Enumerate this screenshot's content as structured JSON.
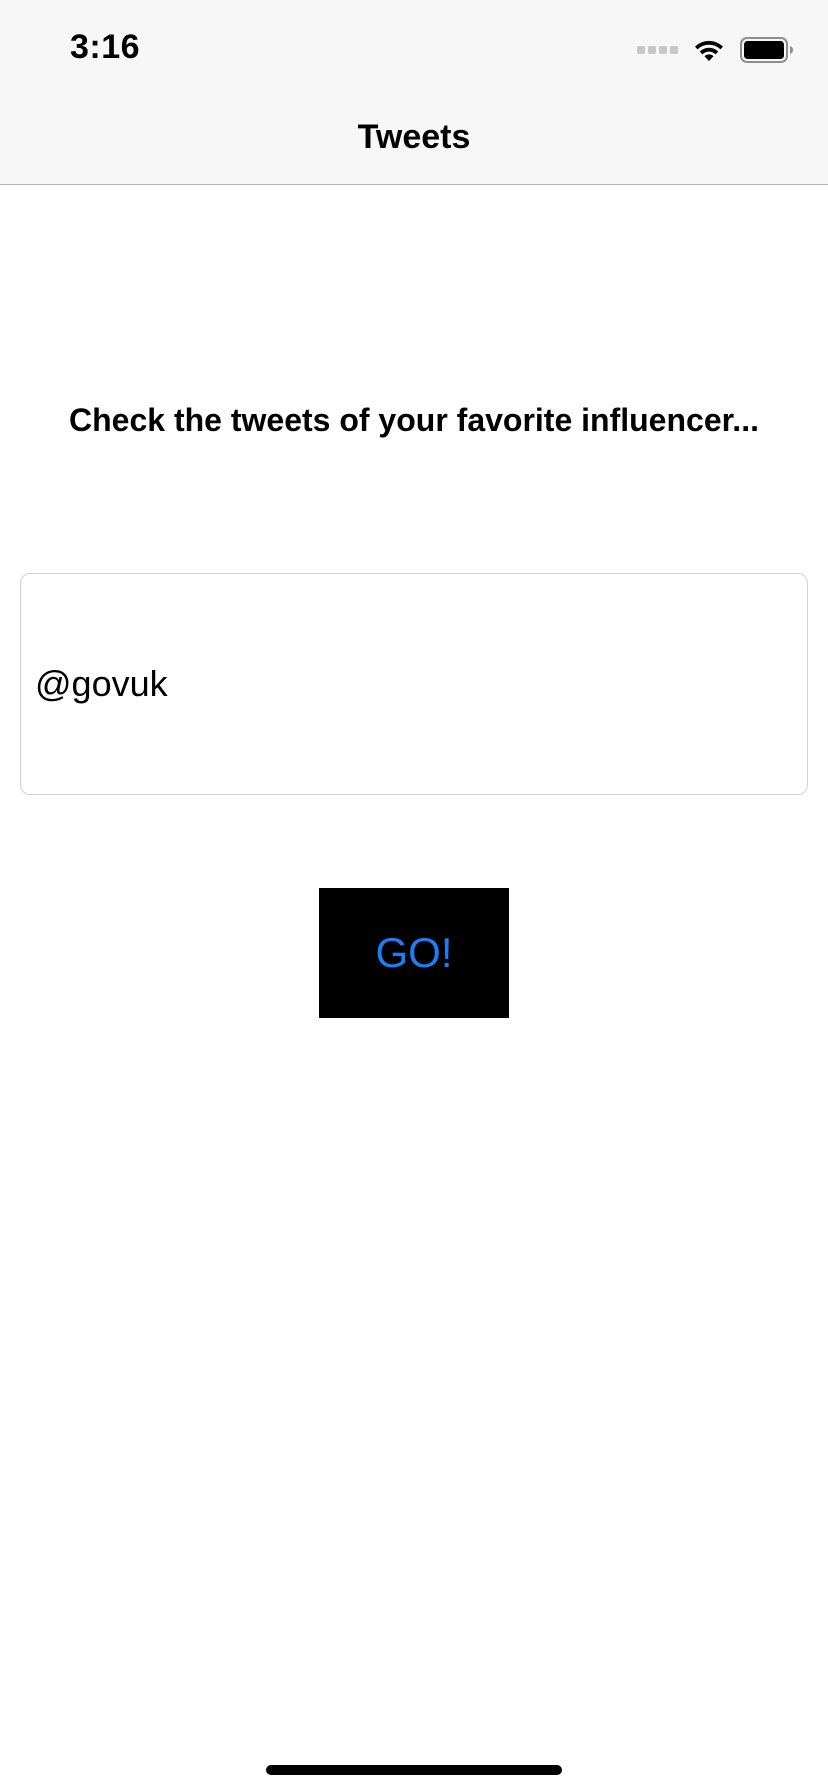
{
  "status_bar": {
    "time": "3:16",
    "icons": [
      "cellular-signal-icon",
      "wifi-icon",
      "battery-icon"
    ]
  },
  "nav": {
    "title": "Tweets"
  },
  "main": {
    "headline": "Check the tweets of your favorite influencer...",
    "handle_input_value": "@govuk",
    "go_button_label": "GO!"
  },
  "colors": {
    "nav_background": "#f7f7f7",
    "button_background": "#000000",
    "button_text": "#1a7ef5"
  }
}
